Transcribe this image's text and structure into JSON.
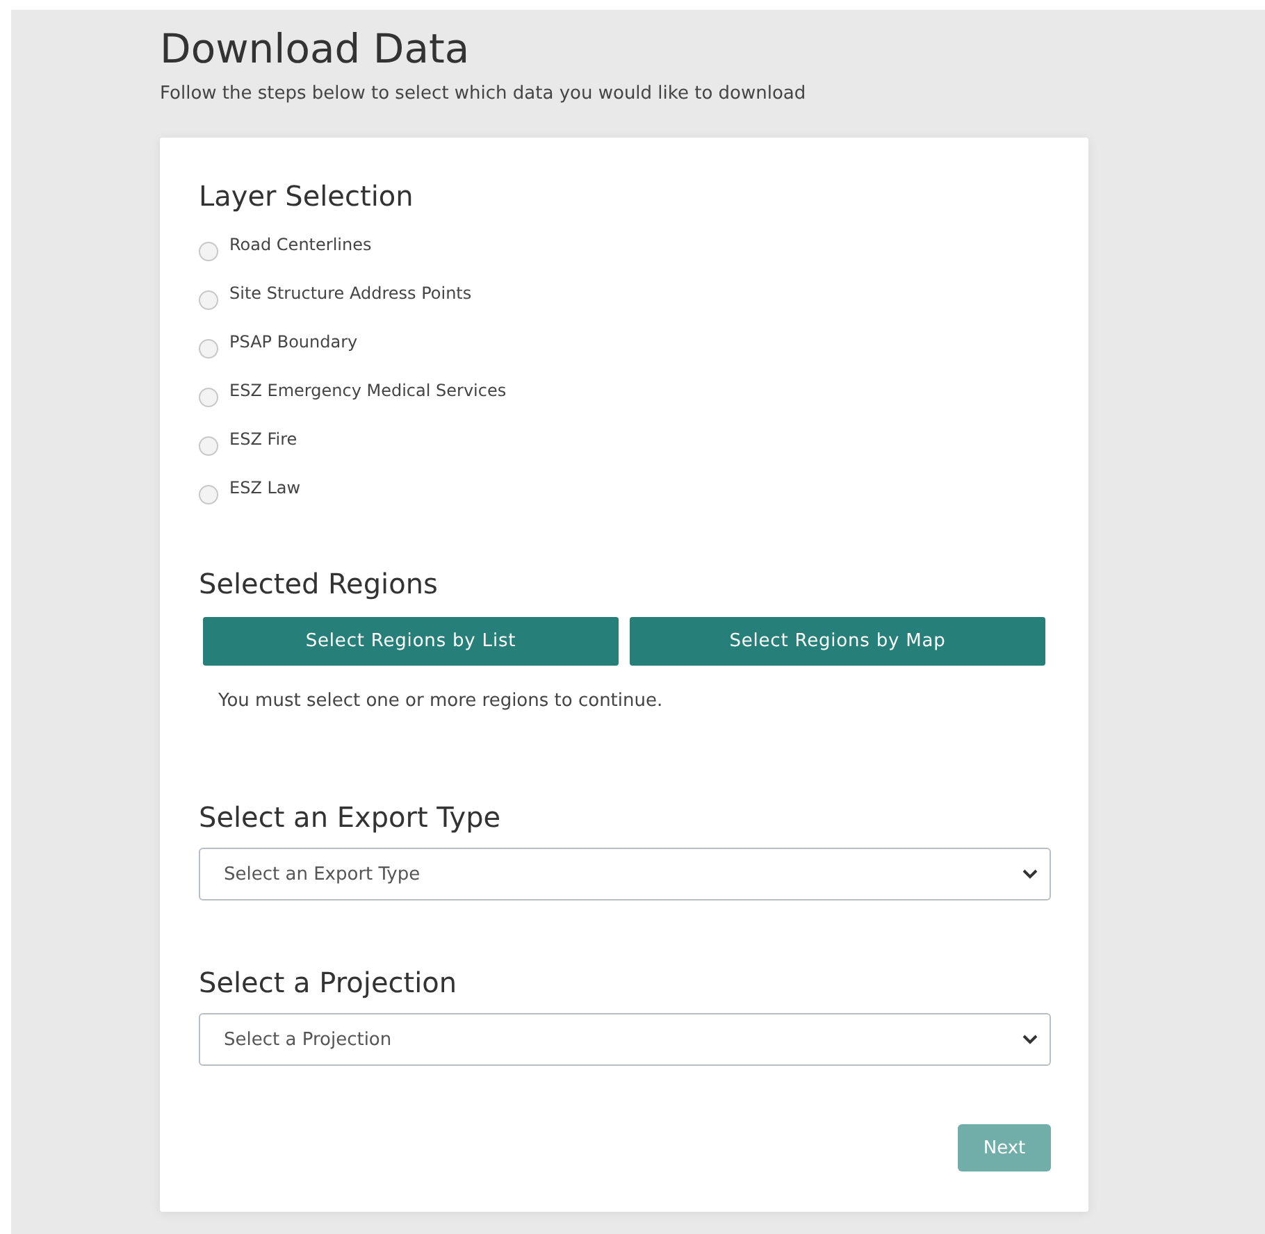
{
  "page": {
    "title": "Download Data",
    "subtitle": "Follow the steps below to select which data you would like to download"
  },
  "layer_selection": {
    "heading": "Layer Selection",
    "options": [
      {
        "label": "Road Centerlines",
        "selected": false
      },
      {
        "label": "Site Structure Address Points",
        "selected": false
      },
      {
        "label": "PSAP Boundary",
        "selected": false
      },
      {
        "label": "ESZ Emergency Medical Services",
        "selected": false
      },
      {
        "label": "ESZ Fire",
        "selected": false
      },
      {
        "label": "ESZ Law",
        "selected": false
      }
    ]
  },
  "selected_regions": {
    "heading": "Selected Regions",
    "buttons": [
      "Select Regions by List",
      "Select Regions by Map"
    ],
    "message": "You must select one or more regions to continue."
  },
  "export_type": {
    "heading": "Select an Export Type",
    "placeholder": "Select an Export Type"
  },
  "projection": {
    "heading": "Select a Projection",
    "placeholder": "Select a Projection"
  },
  "next_button": {
    "label": "Next",
    "disabled": true
  }
}
